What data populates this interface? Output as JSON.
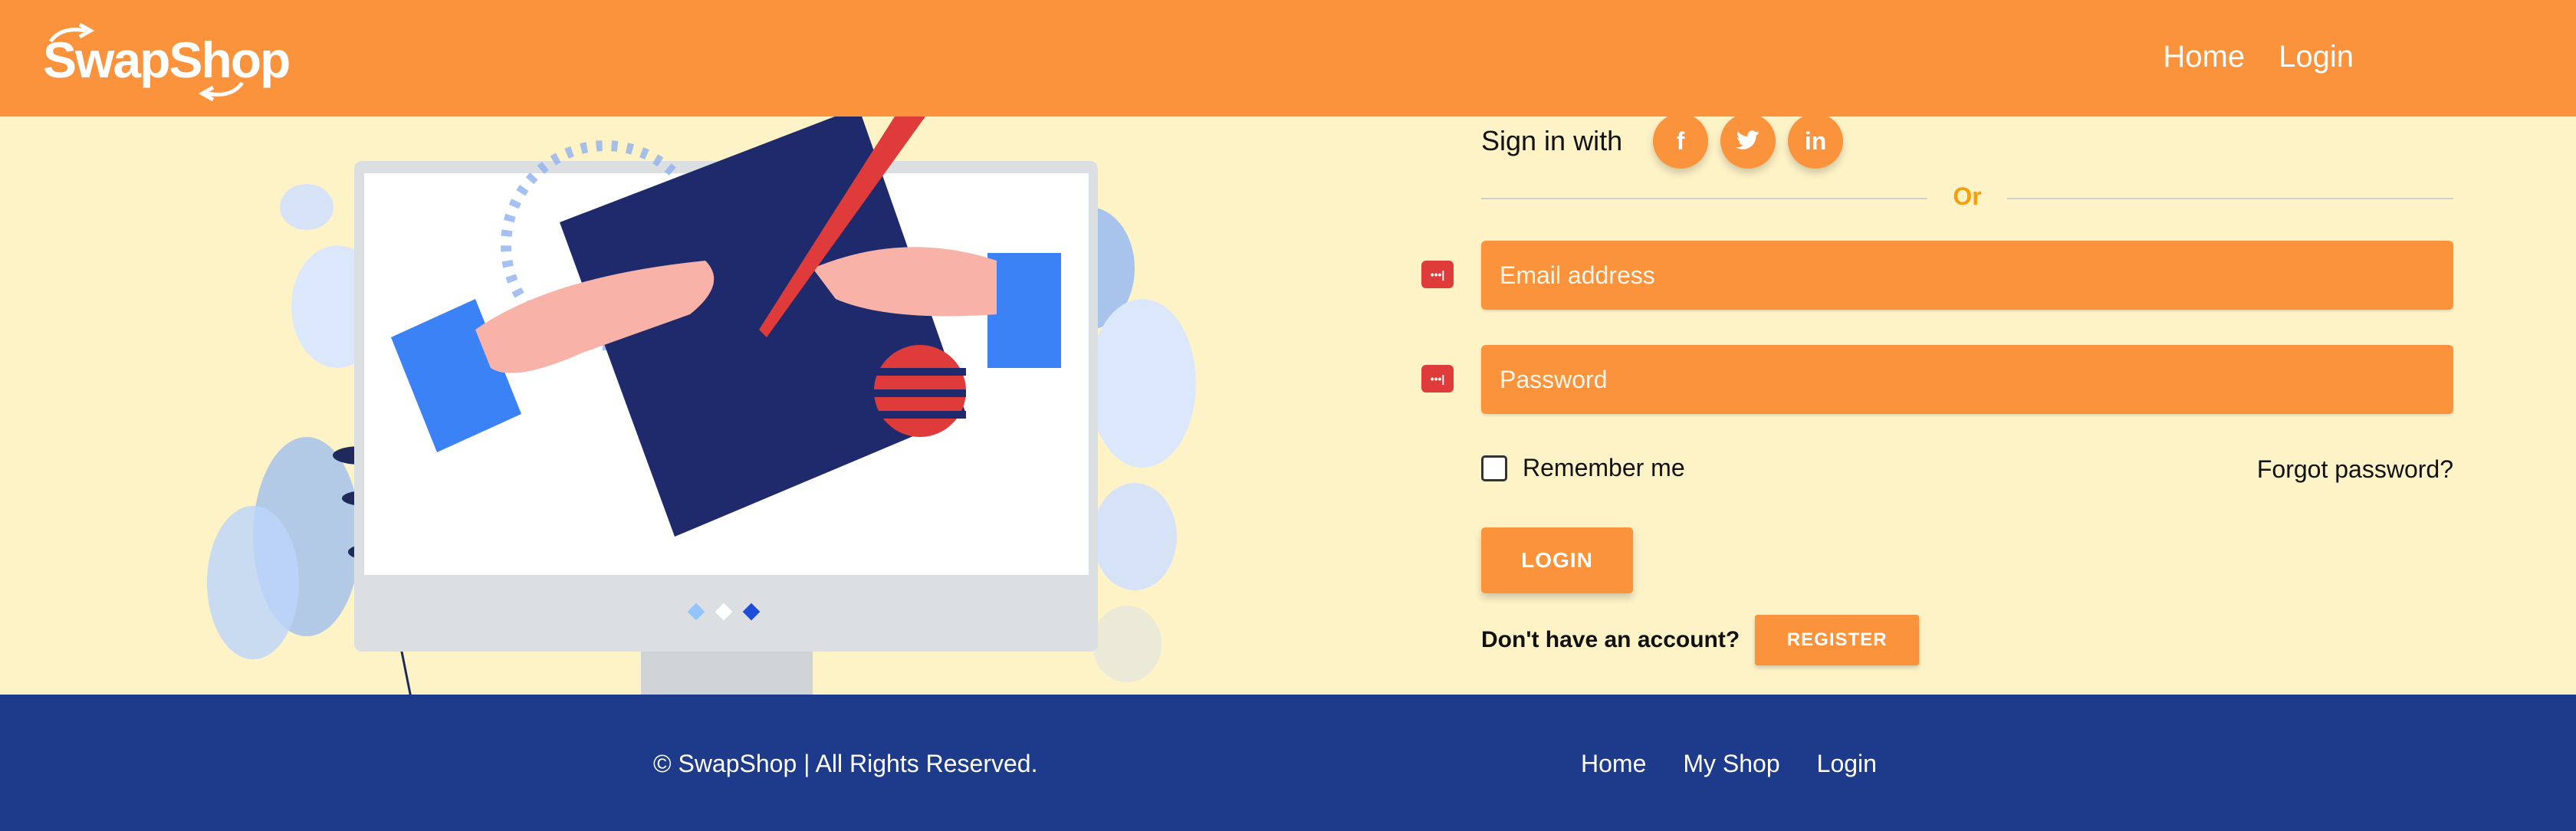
{
  "header": {
    "logo_text": "SwapShop",
    "nav": [
      "Home",
      "Login"
    ]
  },
  "login_form": {
    "sign_in_label": "Sign in with",
    "social": [
      {
        "icon": "facebook-icon",
        "glyph": "f"
      },
      {
        "icon": "twitter-icon",
        "glyph": "t"
      },
      {
        "icon": "linkedin-icon",
        "glyph": "in"
      }
    ],
    "or_text": "Or",
    "email_placeholder": "Email address",
    "password_placeholder": "Password",
    "remember_label": "Remember me",
    "forgot_label": "Forgot password?",
    "login_label": "LOGIN",
    "account_prompt": "Don't have an account?",
    "register_label": "REGISTER"
  },
  "footer": {
    "copyright": "© SwapShop | All Rights Reserved.",
    "nav": [
      "Home",
      "My Shop",
      "Login"
    ]
  },
  "colors": {
    "header_bg": "#fb923c",
    "body_bg": "#fef3c7",
    "footer_bg": "#1e3a8a",
    "accent": "#fb923c"
  }
}
